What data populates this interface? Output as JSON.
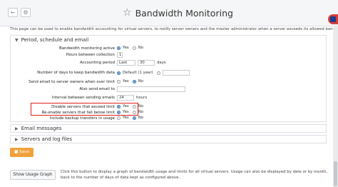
{
  "header": {
    "title": "Bandwidth Monitoring",
    "description": "This page can be used to enable bandwidth accounting for virtual servers, to notify server owners and the master administrator when a server exceeds its allowed bandwidth."
  },
  "sections": {
    "period": "Period, schedule and email",
    "email_messages": "Email messages",
    "servers_logs": "Servers and log files"
  },
  "form": {
    "enabled": {
      "label": "Bandwidth monitoring active",
      "yes": "Yes",
      "no": "No"
    },
    "hours": {
      "label": "Hours between collection",
      "value": "1"
    },
    "accounting": {
      "label": "Accounting period",
      "select": "Last",
      "value": "30",
      "unit": "days"
    },
    "keep_days": {
      "label": "Number of days to keep bandwidth data",
      "option_default": "Default (1 year)",
      "value": ""
    },
    "notify_owner": {
      "label": "Send email to server owners when over limit",
      "yes": "Yes",
      "no": "No"
    },
    "also_send": {
      "label": "Also send email to",
      "value": ""
    },
    "interval": {
      "label": "Interval between sending emails",
      "value": "24",
      "unit": "hours"
    },
    "disable": {
      "label": "Disable servers that exceed limit",
      "yes": "Yes",
      "no": "No"
    },
    "reenable": {
      "label": "Re-enable servers that fall below limit",
      "yes": "Yes",
      "no": "No"
    },
    "backup": {
      "label": "Include backup transfers in usage",
      "yes": "Yes",
      "no": "No"
    }
  },
  "buttons": {
    "save": "Save",
    "show_graph": "Show Usage Graph",
    "show_graph_desc": "Click this button to display a graph of bandwidth usage and limits for all virtual servers. Usage can also be displayed by date or by month, back to the number of days of data kept as configured above."
  },
  "icons": {
    "star": "star-icon",
    "back": "back-icon",
    "gear": "gear-icon",
    "save": "save-icon"
  },
  "colors": {
    "highlight": "#e0201b",
    "save_button": "#f0a23a",
    "radio_selected": "#2a6fb5"
  }
}
